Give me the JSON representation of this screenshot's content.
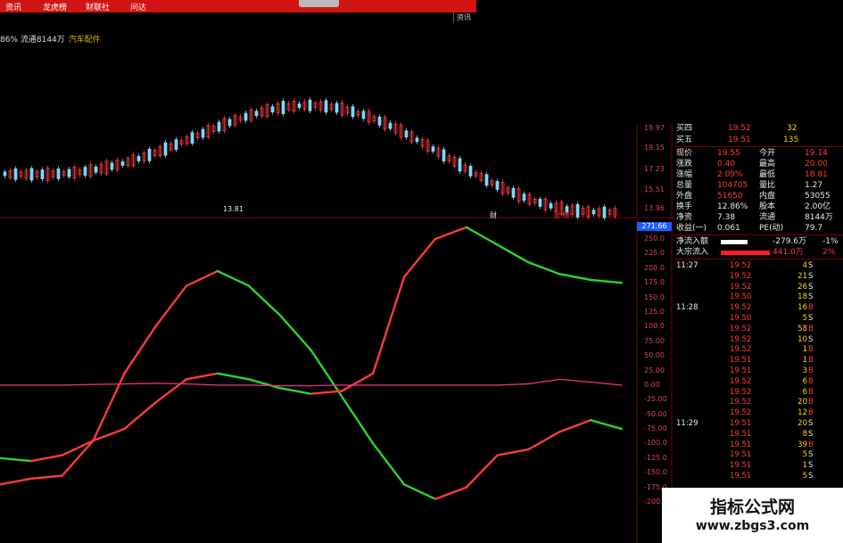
{
  "top_tabs": [
    "资讯",
    "龙虎榜",
    "财联社",
    "问达"
  ],
  "right_tab": "资讯",
  "info_line": {
    "text": "86% 流通8144万",
    "sector": "汽车配件"
  },
  "price_axis": [
    "19.97",
    "19.15",
    "17.23",
    "15.51",
    "13.96"
  ],
  "low_label": "13.81",
  "chart_markers": [
    {
      "label": "财"
    },
    {
      "label": "涨 榜"
    }
  ],
  "indicator_axis": [
    "271.66",
    "250.0",
    "225.0",
    "200.0",
    "175.0",
    "150.0",
    "125.0",
    "100.0",
    "75.00",
    "50.00",
    "25.00",
    "0.00",
    "-25.00",
    "-50.00",
    "-75.00",
    "-100.0",
    "-125.0",
    "-150.0",
    "-175.0",
    "-200.0"
  ],
  "chart_data": {
    "type": "line",
    "ylim": [
      -200,
      271.66
    ],
    "x": [
      0,
      5,
      10,
      15,
      20,
      25,
      30,
      35,
      40,
      45,
      50,
      55,
      60,
      65,
      70,
      75,
      80,
      85,
      90,
      95,
      100
    ],
    "series": [
      {
        "values": [
          -170,
          -160,
          -155,
          -95,
          20,
          100,
          170,
          195,
          170,
          120,
          60,
          -20,
          -100,
          -170,
          -195,
          -175,
          -120,
          -110,
          -80,
          -60,
          -75
        ]
      },
      {
        "values": [
          -125,
          -130,
          -120,
          -95,
          -75,
          -30,
          10,
          20,
          10,
          -5,
          -15,
          -10,
          20,
          185,
          250,
          270,
          240,
          210,
          190,
          180,
          175
        ]
      },
      {
        "values": [
          0,
          0,
          0,
          1,
          2,
          3,
          2,
          0,
          0,
          -1,
          -1,
          0,
          0,
          0,
          0,
          0,
          0,
          2,
          10,
          5,
          0
        ]
      }
    ]
  },
  "right_panel": {
    "quotes": [
      {
        "label": "买四",
        "price": "19.52",
        "vol": "32"
      },
      {
        "label": "买五",
        "price": "19.51",
        "vol": "135"
      }
    ],
    "stats": [
      {
        "l1": "现价",
        "v1": "19.55",
        "l2": "今开",
        "v2": "19.14"
      },
      {
        "l1": "涨跌",
        "v1": "0.40",
        "l2": "最高",
        "v2": "20.00"
      },
      {
        "l1": "涨幅",
        "v1": "2.09%",
        "l2": "最低",
        "v2": "18.81"
      },
      {
        "l1": "总量",
        "v1": "104705",
        "l2": "量比",
        "v2": "1.27"
      },
      {
        "l1": "外盘",
        "v1": "51650",
        "l2": "内盘",
        "v2": "53055"
      },
      {
        "l1": "换手",
        "v1": "12.86%",
        "l2": "股本",
        "v2": "2.00亿"
      },
      {
        "l1": "净资",
        "v1": "7.38",
        "l2": "流通",
        "v2": "8144万"
      },
      {
        "l1": "收益(一)",
        "v1": "0.061",
        "l2": "PE(动)",
        "v2": "79.7"
      }
    ],
    "flows": [
      {
        "label": "净流入额",
        "value": "-279.6万",
        "pct": "-1%"
      },
      {
        "label": "大宗流入",
        "value": "441.0万",
        "pct": "2%"
      }
    ],
    "trades": [
      {
        "time": "11:27",
        "price": "19.52",
        "vol": "4",
        "side": "S"
      },
      {
        "time": "",
        "price": "19.52",
        "vol": "21",
        "side": "S"
      },
      {
        "time": "",
        "price": "19.52",
        "vol": "26",
        "side": "S"
      },
      {
        "time": "",
        "price": "19.50",
        "vol": "18",
        "side": "S"
      },
      {
        "time": "11:28",
        "price": "19.52",
        "vol": "16",
        "side": "B"
      },
      {
        "time": "",
        "price": "19.50",
        "vol": "5",
        "side": "S"
      },
      {
        "time": "",
        "price": "19.52",
        "vol": "58",
        "side": "B"
      },
      {
        "time": "",
        "price": "19.52",
        "vol": "10",
        "side": "S"
      },
      {
        "time": "",
        "price": "19.52",
        "vol": "1",
        "side": "B"
      },
      {
        "time": "",
        "price": "19.51",
        "vol": "1",
        "side": "B"
      },
      {
        "time": "",
        "price": "19.51",
        "vol": "3",
        "side": "B"
      },
      {
        "time": "",
        "price": "19.52",
        "vol": "6",
        "side": "B"
      },
      {
        "time": "",
        "price": "19.52",
        "vol": "6",
        "side": "B"
      },
      {
        "time": "",
        "price": "19.52",
        "vol": "20",
        "side": "B"
      },
      {
        "time": "",
        "price": "19.52",
        "vol": "12",
        "side": "B"
      },
      {
        "time": "11:29",
        "price": "19.51",
        "vol": "20",
        "side": "S"
      },
      {
        "time": "",
        "price": "19.51",
        "vol": "8",
        "side": "S"
      },
      {
        "time": "",
        "price": "19.51",
        "vol": "39",
        "side": "B"
      },
      {
        "time": "",
        "price": "19.51",
        "vol": "5",
        "side": "S"
      },
      {
        "time": "",
        "price": "19.51",
        "vol": "1",
        "side": "S"
      },
      {
        "time": "",
        "price": "19.51",
        "vol": "5",
        "side": "S"
      }
    ]
  },
  "watermark": {
    "title": "指标公式网",
    "url": "www.zbgs3.com"
  },
  "colors": {
    "up": "#ff3b3b",
    "down": "#2fd32f",
    "flat": "#e0307a",
    "candle_down": "#7fd6ff"
  }
}
